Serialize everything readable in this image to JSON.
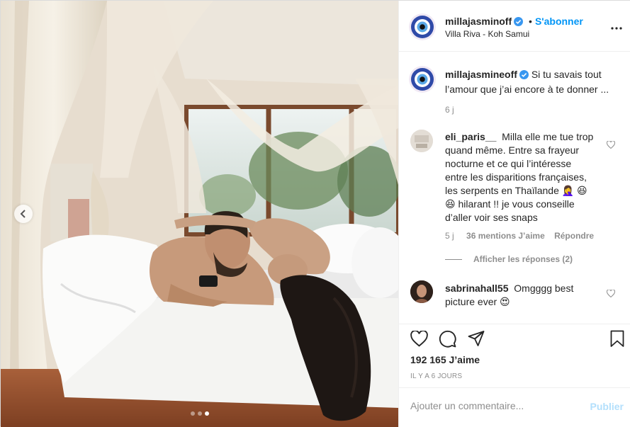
{
  "post": {
    "author": "millajasminoff",
    "follow_label": "S'abonner",
    "separator": "•",
    "location": "Villa Riva - Koh Samui",
    "more_icon": "more-horizontal-icon"
  },
  "media": {
    "carousel_dots": 3,
    "active_dot": 3,
    "prev_icon": "chevron-left-icon"
  },
  "caption": {
    "author": "millajasmineoff",
    "text": "Si tu savais tout l’amour que j’ai encore à te donner ...",
    "age": "6 j"
  },
  "comments": [
    {
      "author": "eli_paris__",
      "lines": [
        "Milla elle me tue trop",
        "quand même. Entre sa frayeur",
        "nocturne et ce qui l’intéresse",
        "entre les disparitions françaises,",
        "les serpents en Thaïlande 🤦‍♀️ 😆",
        "😆 hilarant !! je vous conseille",
        "d’aller voir ses snaps"
      ],
      "age": "5 j",
      "likes": "36 mentions J’aime",
      "reply_label": "Répondre",
      "view_replies": "Afficher les réponses (2)"
    },
    {
      "author": "sabrinahall55",
      "lines": [
        "Omgggg best",
        "picture ever 😍"
      ]
    }
  ],
  "actions": {
    "likes_count": "192 165 J’aime",
    "timestamp": "IL Y A 6 JOURS"
  },
  "composer": {
    "placeholder": "Ajouter un commentaire...",
    "publish_label": "Publier"
  },
  "colors": {
    "accent": "#0095f6",
    "publish_disabled": "#b2dffc",
    "muted": "#8e8e8e",
    "border": "#efefef"
  }
}
